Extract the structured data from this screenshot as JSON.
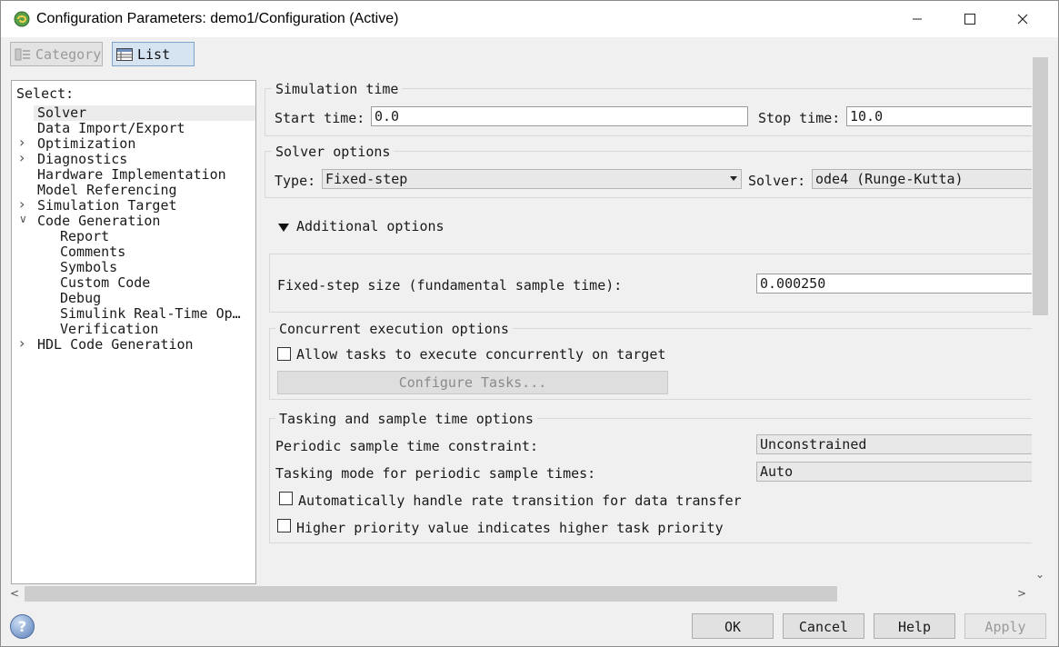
{
  "window": {
    "title": "Configuration Parameters: demo1/Configuration (Active)",
    "controls": [
      "minimize",
      "maximize",
      "close"
    ]
  },
  "toolbar": {
    "category_label": "Category",
    "list_label": "List"
  },
  "tree": {
    "select_label": "Select:",
    "items": [
      {
        "label": "Solver",
        "selected": true,
        "expander": ""
      },
      {
        "label": "Data Import/Export",
        "expander": ""
      },
      {
        "label": "Optimization",
        "expander": "collapsed"
      },
      {
        "label": "Diagnostics",
        "expander": "collapsed"
      },
      {
        "label": "Hardware Implementation",
        "expander": ""
      },
      {
        "label": "Model Referencing",
        "expander": ""
      },
      {
        "label": "Simulation Target",
        "expander": "collapsed"
      },
      {
        "label": "Code Generation",
        "expander": "expanded"
      },
      {
        "label": "Report",
        "child": true
      },
      {
        "label": "Comments",
        "child": true
      },
      {
        "label": "Symbols",
        "child": true
      },
      {
        "label": "Custom Code",
        "child": true
      },
      {
        "label": "Debug",
        "child": true
      },
      {
        "label": "Simulink Real-Time Op…",
        "child": true
      },
      {
        "label": "Verification",
        "child": true
      },
      {
        "label": "HDL Code Generation",
        "expander": "collapsed"
      }
    ]
  },
  "simulation_time": {
    "title": "Simulation time",
    "start_label": "Start time:",
    "start_value": "0.0",
    "stop_label": "Stop time:",
    "stop_value": "10.0"
  },
  "solver_options": {
    "title": "Solver options",
    "type_label": "Type:",
    "type_value": "Fixed-step",
    "solver_label": "Solver:",
    "solver_value": "ode4 (Runge-Kutta)"
  },
  "additional_options": {
    "label": "Additional options",
    "fixed_step_label": "Fixed-step size (fundamental sample time):",
    "fixed_step_value": "0.000250"
  },
  "concurrent": {
    "title": "Concurrent execution options",
    "allow_label": "Allow tasks to execute concurrently on target",
    "allow_checked": false,
    "configure_label": "Configure Tasks..."
  },
  "tasking": {
    "title": "Tasking and sample time options",
    "periodic_label": "Periodic sample time constraint:",
    "periodic_value": "Unconstrained",
    "mode_label": "Tasking mode for periodic sample times:",
    "mode_value": "Auto",
    "auto_rate_label": "Automatically handle rate transition for data transfer",
    "auto_rate_checked": false,
    "priority_label": "Higher priority value indicates higher task priority",
    "priority_checked": false
  },
  "buttons": {
    "ok": "OK",
    "cancel": "Cancel",
    "help": "Help",
    "apply": "Apply"
  }
}
